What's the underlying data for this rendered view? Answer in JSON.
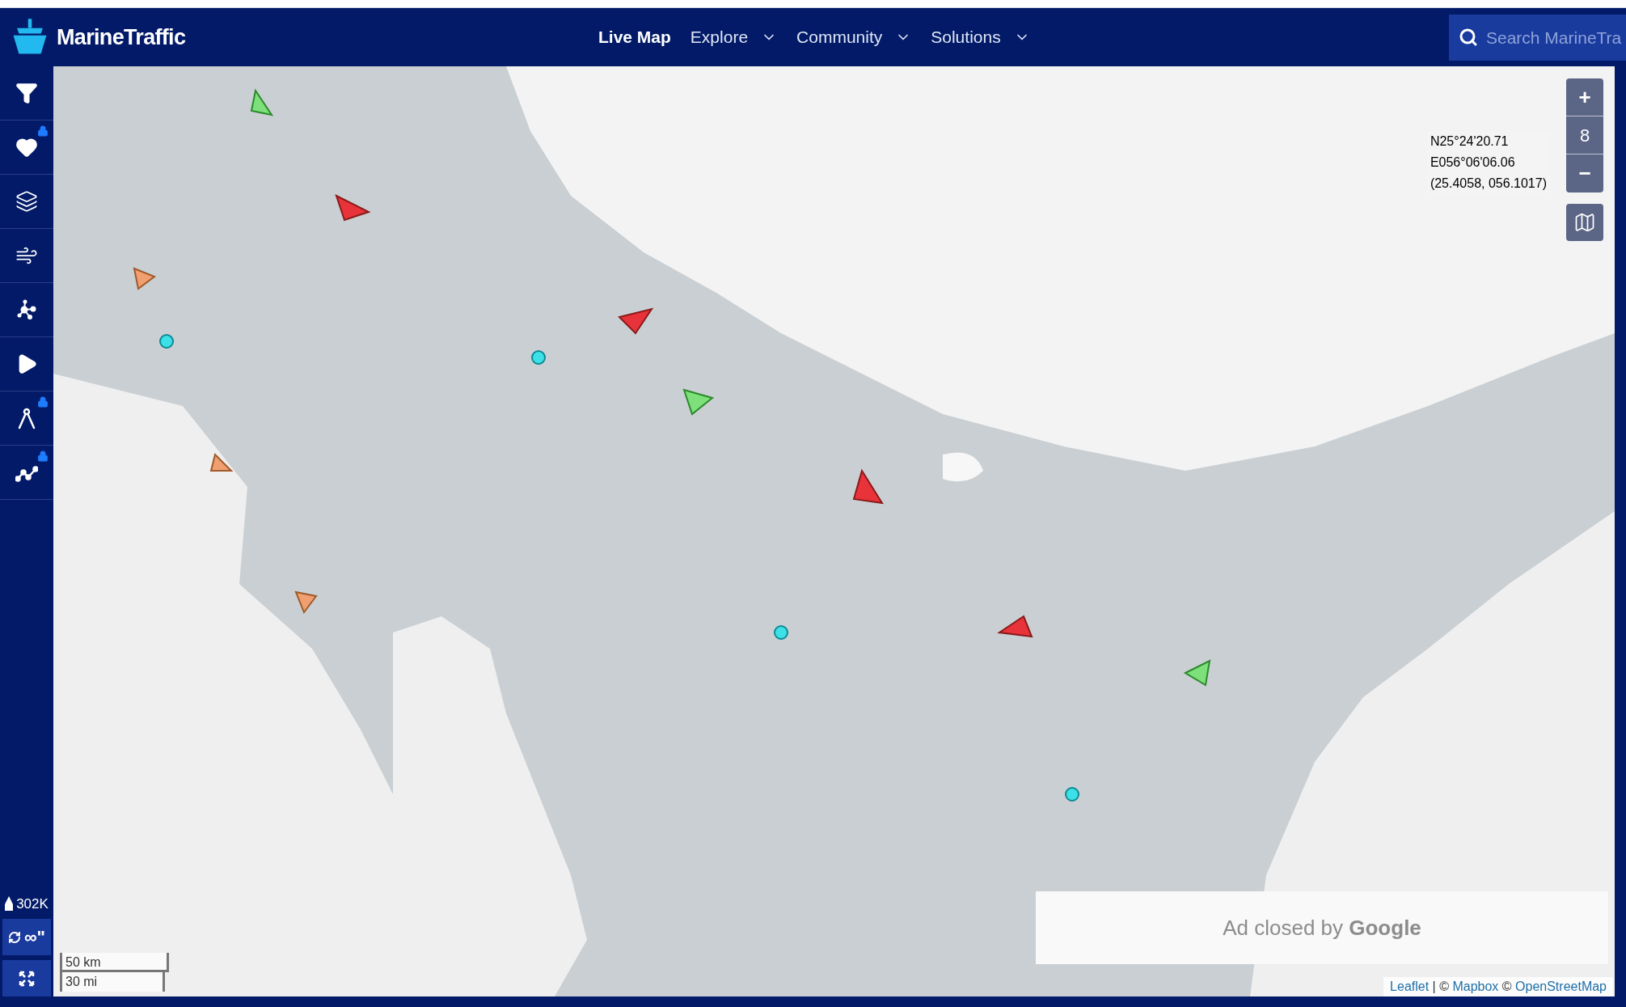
{
  "header": {
    "logo": "MarineTraffic",
    "nav": [
      {
        "label": "Live Map",
        "selected": true,
        "dropdown": false
      },
      {
        "label": "Explore",
        "selected": false,
        "dropdown": true
      },
      {
        "label": "Community",
        "selected": false,
        "dropdown": true
      },
      {
        "label": "Solutions",
        "selected": false,
        "dropdown": true
      }
    ],
    "search": {
      "placeholder": "Search MarineTra"
    }
  },
  "sidebar": {
    "tools": [
      {
        "kind": "filter",
        "locked": false
      },
      {
        "kind": "favorites",
        "locked": true
      },
      {
        "kind": "layers",
        "locked": false
      },
      {
        "kind": "weather",
        "locked": false
      },
      {
        "kind": "network",
        "locked": false
      },
      {
        "kind": "play",
        "locked": false
      },
      {
        "kind": "measure",
        "locked": true
      },
      {
        "kind": "analytics",
        "locked": true
      }
    ],
    "vessel_count": "302K",
    "refresh_label": "∞\""
  },
  "map": {
    "zoom": {
      "plus": "+",
      "level": "8",
      "minus": "−"
    },
    "coordinates": [
      "N25°24'20.71",
      "E056°06'06.06",
      "(25.4058, 056.1017)"
    ],
    "scale": [
      "50 km",
      "30 mi"
    ],
    "ad": "Ad closed by **Google**",
    "attribution": [
      {
        "text": "Leaflet",
        "link": true
      },
      {
        "text": " | © ",
        "link": false
      },
      {
        "text": "Mapbox",
        "link": true
      },
      {
        "text": " © ",
        "link": false
      },
      {
        "text": "OpenStreetMap",
        "link": true
      }
    ]
  }
}
